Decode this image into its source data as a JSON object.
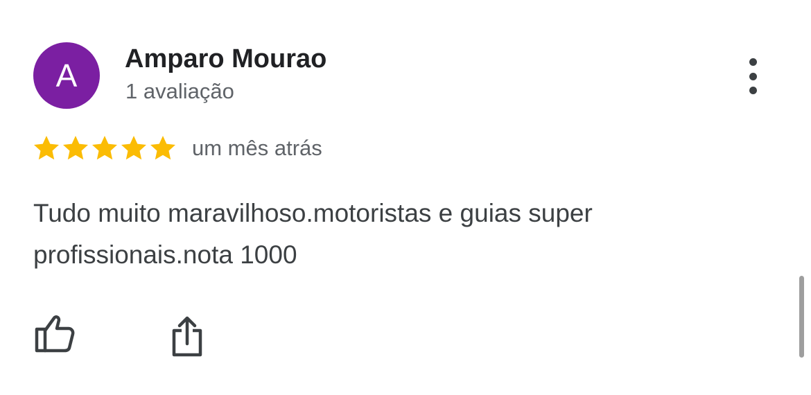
{
  "review": {
    "author": {
      "initial": "A",
      "name": "Amparo Mourao",
      "review_count": "1 avaliação",
      "avatar_color": "#7b1fa2"
    },
    "rating": 5,
    "rating_max": 5,
    "star_color": "#fbbc04",
    "date": "um mês atrás",
    "text_line1": "Tudo muito maravilhoso.motoristas e guias super",
    "text_line2": "profissionais.nota 1000",
    "actions": {
      "like_icon": "thumbs-up-icon",
      "share_icon": "share-icon",
      "more_icon": "more-vert-icon"
    }
  }
}
